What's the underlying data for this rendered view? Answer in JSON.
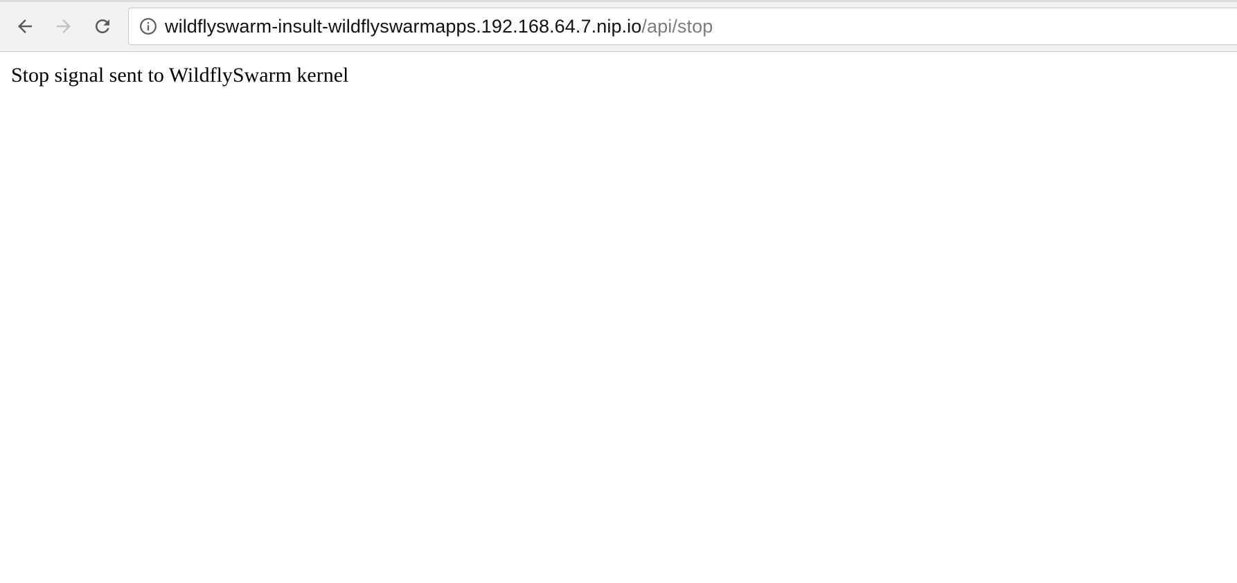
{
  "browser": {
    "address_bar": {
      "host": "wildflyswarm-insult-wildflyswarmapps.192.168.64.7.nip.io",
      "path": "/api/stop"
    },
    "icons": {
      "back": "back-arrow-icon",
      "forward": "forward-arrow-icon",
      "reload": "reload-icon",
      "site_info": "info-icon"
    }
  },
  "page": {
    "body_text": "Stop signal sent to WildflySwarm kernel"
  },
  "colors": {
    "toolbar_bg": "#f2f2f2",
    "url_host": "#111111",
    "url_path": "#7d7d7d",
    "disabled_icon": "#c4c4c4",
    "enabled_icon": "#5a5a5a"
  }
}
